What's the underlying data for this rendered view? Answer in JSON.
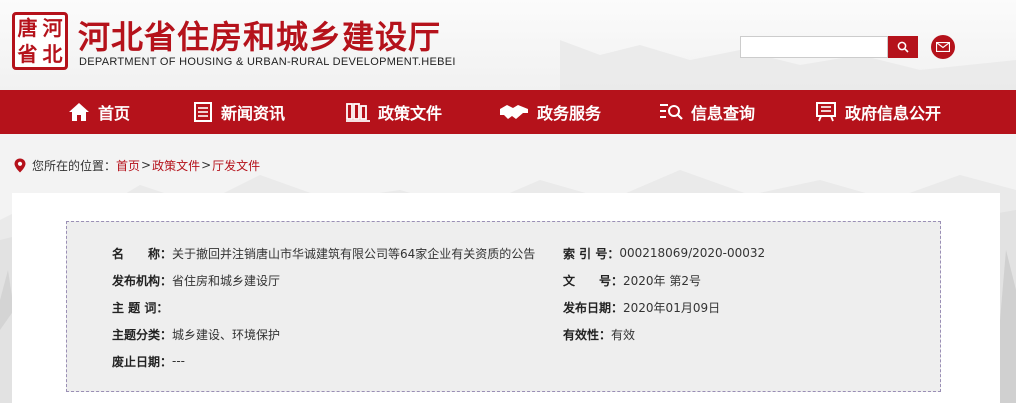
{
  "header": {
    "seal_chars": [
      "河",
      "唐",
      "北",
      "省"
    ],
    "title": "河北省住房和城乡建设厅",
    "subtitle": "DEPARTMENT OF HOUSING & URBAN-RURAL DEVELOPMENT.HEBEI",
    "search_placeholder": "",
    "accent_color": "#b5121b"
  },
  "nav": {
    "items": [
      {
        "label": "首页",
        "icon": "home-icon"
      },
      {
        "label": "新闻资讯",
        "icon": "document-icon"
      },
      {
        "label": "政策文件",
        "icon": "books-icon"
      },
      {
        "label": "政务服务",
        "icon": "handshake-icon"
      },
      {
        "label": "信息查询",
        "icon": "search-list-icon"
      },
      {
        "label": "政府信息公开",
        "icon": "board-icon"
      }
    ]
  },
  "breadcrumb": {
    "prefix": "您所在的位置：",
    "items": [
      "首页",
      "政策文件",
      "厅发文件"
    ],
    "separator": ">"
  },
  "info": {
    "name_label": "名　　称：",
    "name_value": "关于撤回并注销唐山市华诚建筑有限公司等64家企业有关资质的公告",
    "index_label": "索 引 号：",
    "index_value": "000218069/2020-00032",
    "org_label": "发布机构：",
    "org_value": "省住房和城乡建设厅",
    "docno_label": "文　　号：",
    "docno_value": "2020年 第2号",
    "keywords_label": "主 题 词：",
    "keywords_value": "",
    "date_label": "发布日期：",
    "date_value": "2020年01月09日",
    "category_label": "主题分类：",
    "category_value": "城乡建设、环境保护",
    "validity_label": "有效性：",
    "validity_value": "有效",
    "expiry_label": "废止日期：",
    "expiry_value": "---"
  }
}
